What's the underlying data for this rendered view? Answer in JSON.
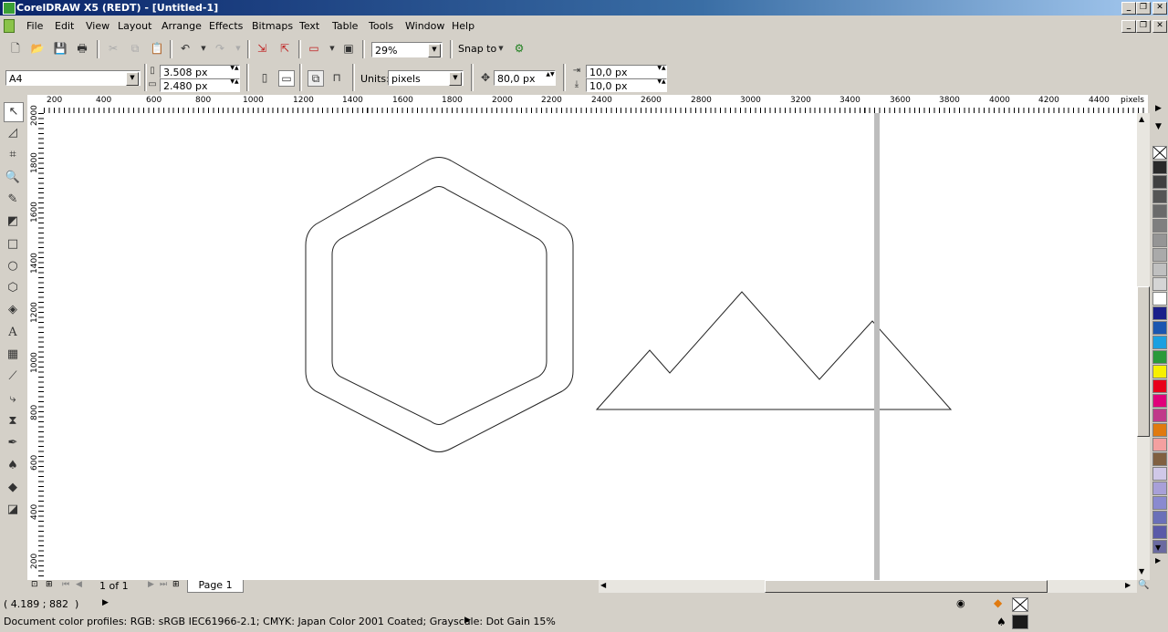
{
  "window": {
    "title": "CorelDRAW X5 (REDT) - [Untitled-1]"
  },
  "menu": {
    "items": [
      "File",
      "Edit",
      "View",
      "Layout",
      "Arrange",
      "Effects",
      "Bitmaps",
      "Text",
      "Table",
      "Tools",
      "Window",
      "Help"
    ]
  },
  "standard_toolbar": {
    "zoom_value": "29%",
    "snap_to_label": "Snap to"
  },
  "property_bar": {
    "paper_size": "A4",
    "width_value": "3.508 px",
    "height_value": "2.480 px",
    "units_label": "Units:",
    "units_value": "pixels",
    "nudge_value": "80,0 px",
    "dup_x_value": "10,0 px",
    "dup_y_value": "10,0 px"
  },
  "rulers": {
    "horizontal_ticks": [
      "200",
      "400",
      "600",
      "800",
      "1000",
      "1200",
      "1400",
      "1600",
      "1800",
      "2000",
      "2200",
      "2400",
      "2600",
      "2800",
      "3000",
      "3200",
      "3400",
      "3600",
      "3800",
      "4000",
      "4200",
      "4400"
    ],
    "horizontal_unit": "pixels",
    "vertical_ticks": [
      "2000",
      "1800",
      "1600",
      "1400",
      "1200",
      "1000",
      "800",
      "600",
      "400",
      "200"
    ],
    "vertical_unit": "pixels"
  },
  "page_nav": {
    "page_count_text": "1 of 1",
    "page_tab": "Page 1"
  },
  "status": {
    "cursor_position": "( 4.189 ; 882  )",
    "color_profiles": "Document color profiles: RGB: sRGB IEC61966-2.1; CMYK: Japan Color 2001 Coated; Grayscale: Dot Gain 15%"
  },
  "palette": {
    "colors": [
      "#2a2a2a",
      "#404040",
      "#555555",
      "#6a6a6a",
      "#7f7f7f",
      "#959595",
      "#aaaaaa",
      "#c0c0c0",
      "#d5d5d5",
      "#ffffff",
      "#1b1f8a",
      "#1a56b0",
      "#1aa0e0",
      "#2a9a3a",
      "#f7f000",
      "#e8001a",
      "#e0007a",
      "#c03a8a",
      "#e07a10",
      "#f4a0a0",
      "#806040",
      "#d0c8e8",
      "#a8a0d8",
      "#8a8ad0",
      "#6a70b8",
      "#5a5aa8",
      "#6a6aa0"
    ]
  }
}
